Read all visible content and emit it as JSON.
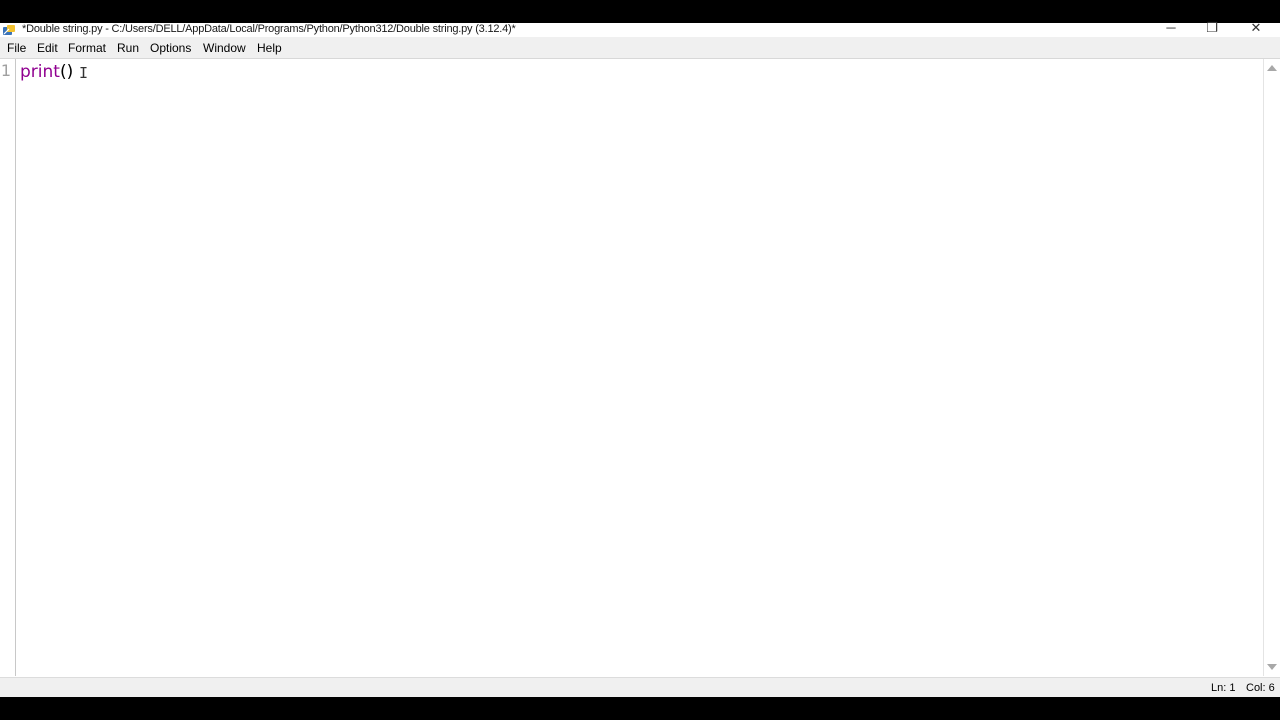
{
  "window": {
    "title": "*Double string.py - C:/Users/DELL/AppData/Local/Programs/Python/Python312/Double string.py (3.12.4)*",
    "app_icon": "python-idle-icon",
    "controls": {
      "minimize": "─",
      "maximize": "❐",
      "close": "✕"
    }
  },
  "menubar": {
    "items": [
      {
        "label": "File"
      },
      {
        "label": "Edit"
      },
      {
        "label": "Format"
      },
      {
        "label": "Run"
      },
      {
        "label": "Options"
      },
      {
        "label": "Window"
      },
      {
        "label": "Help"
      }
    ]
  },
  "editor": {
    "line_numbers": [
      "1"
    ],
    "lines": [
      {
        "builtin": "print",
        "rest": "()"
      }
    ],
    "cursor_glyph": "I"
  },
  "statusbar": {
    "ln": "Ln: 1",
    "col": "Col: 6"
  },
  "colors": {
    "builtin": "#900090",
    "background": "#ffffff",
    "chrome": "#f0f0f0"
  }
}
